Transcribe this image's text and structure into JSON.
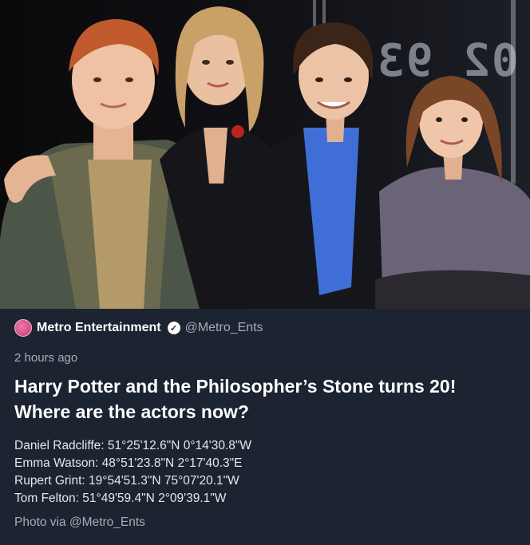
{
  "post": {
    "account_name": "Metro Entertainment",
    "handle": "@Metro_Ents",
    "timestamp": "2 hours ago",
    "headline": "Harry Potter and the Philosopher’s Stone turns 20! Where are the actors now?",
    "coordinates": [
      "Daniel Radcliffe: 51°25'12.6\"N 0°14'30.8\"W",
      "Emma Watson: 48°51'23.8\"N 2°17'40.3\"E",
      "Rupert Grint: 19°54'51.3\"N 75°07'20.1\"W",
      "Tom Felton: 51°49'59.4\"N 2°09'39.1\"W"
    ],
    "credit": "Photo via @Metro_Ents"
  },
  "photo": {
    "backdrop_text": "02 93"
  },
  "icons": {
    "avatar": "metro-avatar",
    "verified": "verified-badge-icon"
  },
  "colors": {
    "background": "#1c2331",
    "secondary_text": "#a6adb8",
    "primary_text": "#ffffff"
  }
}
